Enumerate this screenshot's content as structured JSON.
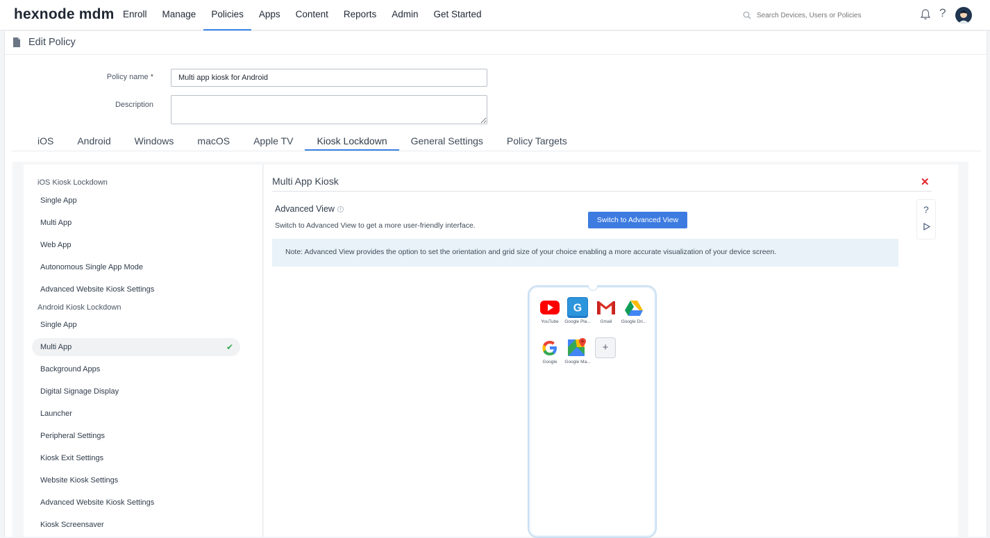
{
  "topbar": {
    "logo": "hexnode mdm",
    "nav": [
      "Enroll",
      "Manage",
      "Policies",
      "Apps",
      "Content",
      "Reports",
      "Admin",
      "Get Started"
    ],
    "active_nav": "Policies",
    "search_placeholder": "Search Devices, Users or Policies"
  },
  "page": {
    "title": "Edit Policy",
    "policy_name_label": "Policy name",
    "required_mark": "*",
    "policy_name_value": "Multi app kiosk for Android",
    "description_label": "Description",
    "description_value": ""
  },
  "tabs": [
    "iOS",
    "Android",
    "Windows",
    "macOS",
    "Apple TV",
    "Kiosk Lockdown",
    "General Settings",
    "Policy Targets"
  ],
  "active_tab": "Kiosk Lockdown",
  "sidebar": {
    "ios_group": "iOS Kiosk Lockdown",
    "ios_items": [
      "Single App",
      "Multi App",
      "Web App",
      "Autonomous Single App Mode",
      "Advanced Website Kiosk Settings"
    ],
    "android_group": "Android Kiosk Lockdown",
    "android_items": [
      "Single App",
      "Multi App",
      "Background Apps",
      "Digital Signage Display",
      "Launcher",
      "Peripheral Settings",
      "Kiosk Exit Settings",
      "Website Kiosk Settings",
      "Advanced Website Kiosk Settings",
      "Kiosk Screensaver"
    ],
    "active_item": "Multi App",
    "check": "✔"
  },
  "main": {
    "section_title": "Multi App Kiosk",
    "advanced_view_title": "Advanced View",
    "advanced_view_desc": "Switch to Advanced View to get a more user-friendly interface.",
    "switch_button": "Switch to Advanced View",
    "note": "Note: Advanced View provides the option to set the orientation and grid size of your choice enabling a more accurate visualization of your device screen.",
    "help": "?",
    "close": "✕",
    "add": "+"
  },
  "apps": [
    {
      "name": "YouTube",
      "icon": "youtube-icon"
    },
    {
      "name": "Google Pla...",
      "icon": "google-play-icon"
    },
    {
      "name": "Gmail",
      "icon": "gmail-icon"
    },
    {
      "name": "Google Dri...",
      "icon": "google-drive-icon"
    },
    {
      "name": "Google",
      "icon": "google-icon"
    },
    {
      "name": "Google Ma...",
      "icon": "google-maps-icon"
    }
  ],
  "colors": {
    "accent": "#3d7be0",
    "close": "#e0242b",
    "check": "#33a853",
    "note_bg": "#e8f2f8"
  }
}
